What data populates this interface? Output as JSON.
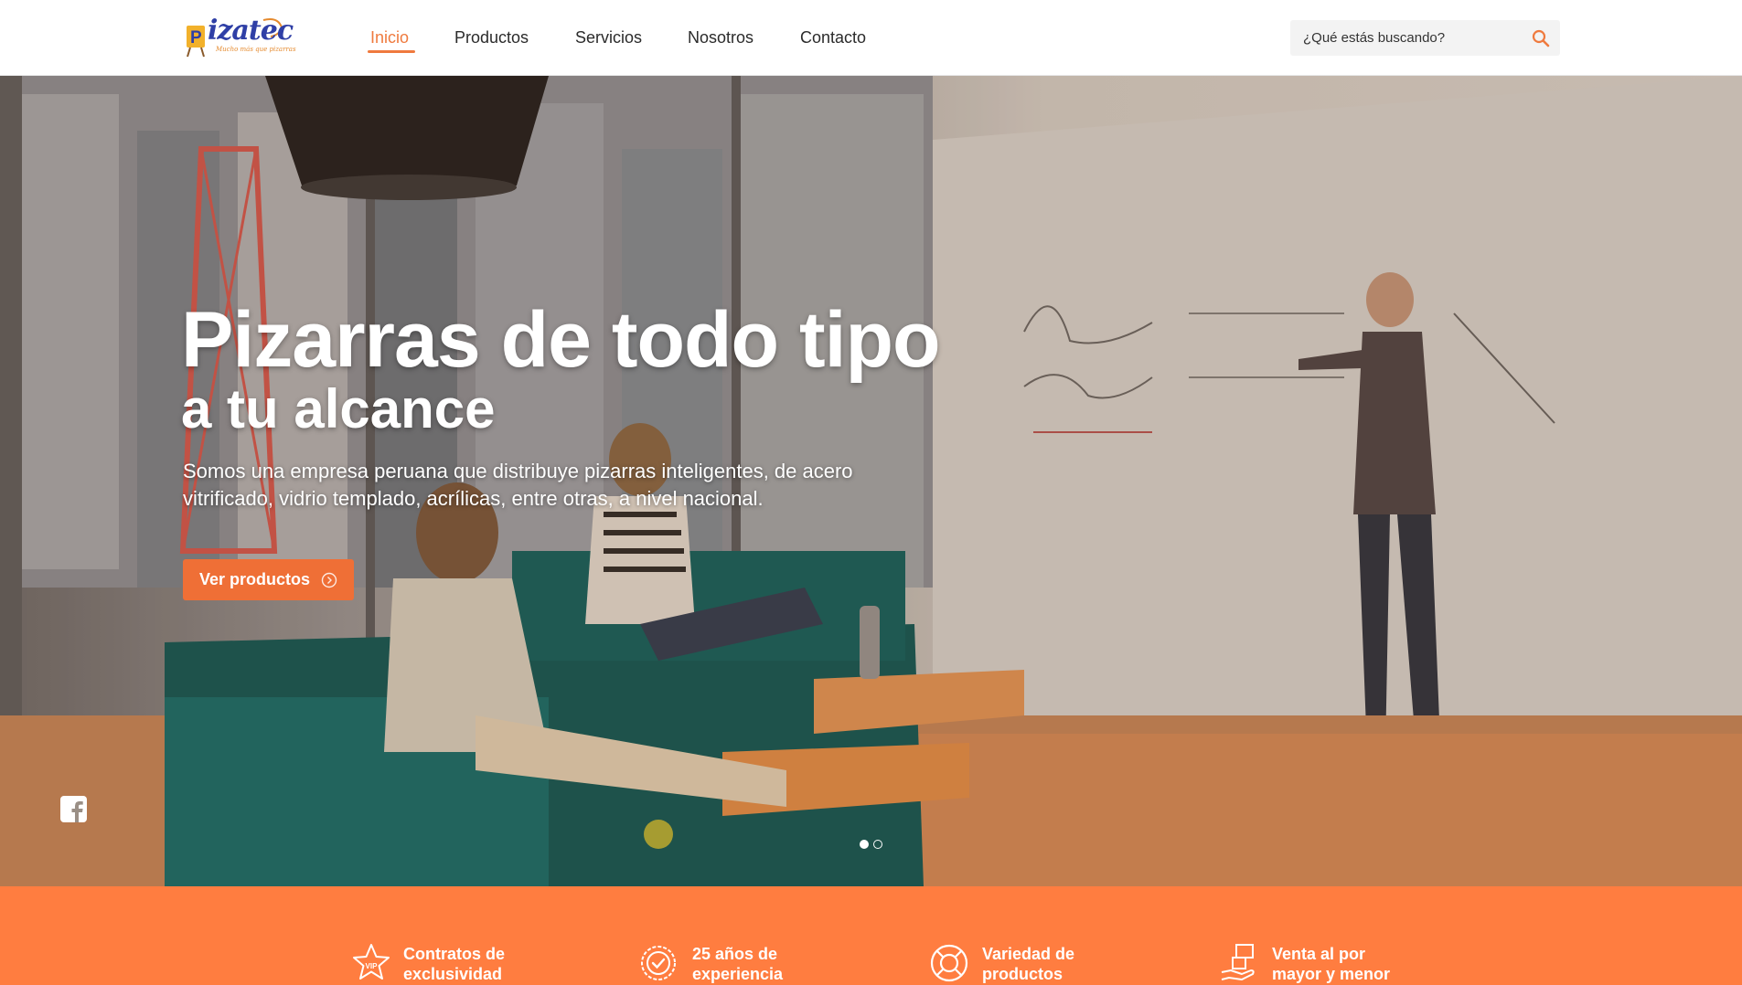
{
  "brand": {
    "logo_text": "izatec",
    "logo_letter": "P",
    "logo_tagline": "Mucho más que pizarras",
    "accent_color": "#ef7a3e"
  },
  "nav": {
    "items": [
      {
        "label": "Inicio",
        "active": true
      },
      {
        "label": "Productos",
        "active": false
      },
      {
        "label": "Servicios",
        "active": false
      },
      {
        "label": "Nosotros",
        "active": false
      },
      {
        "label": "Contacto",
        "active": false
      }
    ]
  },
  "search": {
    "placeholder": "¿Qué estás buscando?",
    "icon": "search-icon"
  },
  "hero": {
    "title": "Pizarras de todo tipo",
    "subtitle": "a tu alcance",
    "description": "Somos una empresa peruana que distribuye pizarras inteligentes, de acero vitrificado, vidrio templado, acrílicas, entre otras, a nivel nacional.",
    "cta_label": "Ver productos",
    "cta_icon": "arrow-circle-icon",
    "slides_total": 2,
    "slide_active": 1
  },
  "social": {
    "icon": "facebook-icon"
  },
  "features": [
    {
      "icon": "vip-star-icon",
      "line1": "Contratos de",
      "line2": "exclusividad"
    },
    {
      "icon": "badge-check-icon",
      "line1": "25 años de",
      "line2": "experiencia"
    },
    {
      "icon": "lifebuoy-icon",
      "line1": "Variedad de",
      "line2": "productos"
    },
    {
      "icon": "hand-boxes-icon",
      "line1": "Venta al por",
      "line2": "mayor y menor"
    }
  ]
}
